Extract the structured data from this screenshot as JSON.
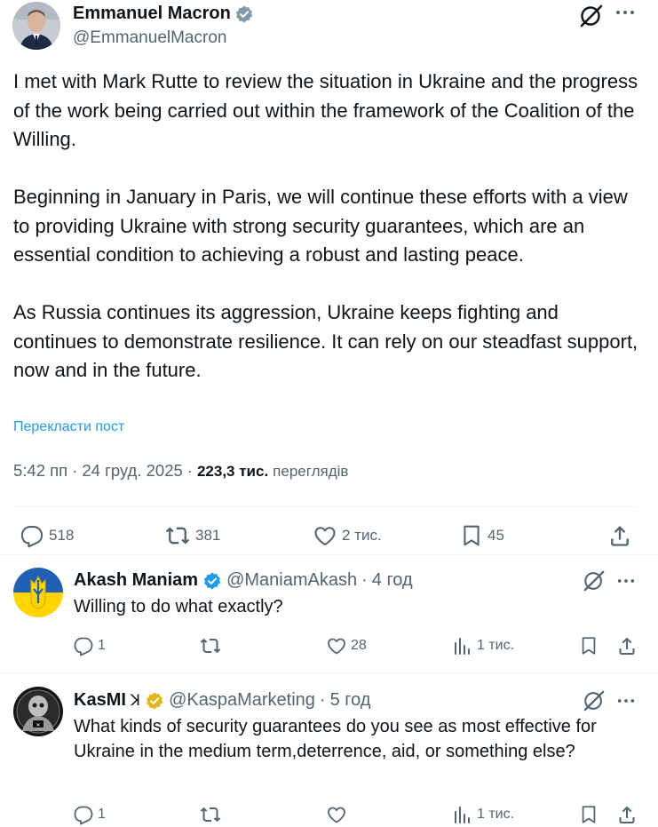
{
  "post": {
    "author_name": "Emmanuel Macron",
    "author_handle": "@EmmanuelMacron",
    "verified_badge": "verified-badge-gray",
    "paragraphs": [
      "I met with Mark Rutte to review the situation in Ukraine and the progress of the work being carried out within the framework of the Coalition of the Willing.",
      "Beginning in January in Paris, we will continue these efforts with a view to providing Ukraine with strong security guarantees, which are an essential condition to achieving a robust and lasting peace.",
      "As Russia continues its aggression, Ukraine keeps fighting and continues to demonstrate resilience. It can rely on our steadfast support, now and in the future."
    ],
    "translate_label": "Перекласти пост",
    "time": "5:42 пп",
    "date": "24 груд. 2025",
    "views_count": "223,3 тис.",
    "views_label": "переглядів",
    "stats": {
      "replies": "518",
      "reposts": "381",
      "likes": "2 тис.",
      "bookmarks": "45"
    }
  },
  "replies": [
    {
      "name": "Akash Maniam",
      "handle": "@ManiamAkash",
      "sep": "·",
      "time": "4 год",
      "badge": "verified-badge-blue",
      "text": "Willing to do what exactly?",
      "stats": {
        "replies": "1",
        "reposts": "",
        "likes": "28",
        "views": "1 тис."
      }
    },
    {
      "name": "KasMI",
      "name_suffix": "ꓘ",
      "handle": "@KaspaMarketing",
      "sep": "·",
      "time": "5 год",
      "badge": "verified-badge-gold",
      "text": "What kinds of security guarantees do you see as most effective for Ukraine in the medium term,deterrence, aid, or something else?",
      "stats": {
        "replies": "1",
        "reposts": "",
        "likes": "",
        "views": "1 тис."
      }
    }
  ],
  "colors": {
    "text": "#0f1419",
    "secondary": "#536471",
    "link": "#1d9bf0",
    "verified_blue": "#1d9bf0",
    "verified_gold": "#e2b719",
    "verified_gray": "#829aab",
    "divider": "#eff3f4"
  }
}
